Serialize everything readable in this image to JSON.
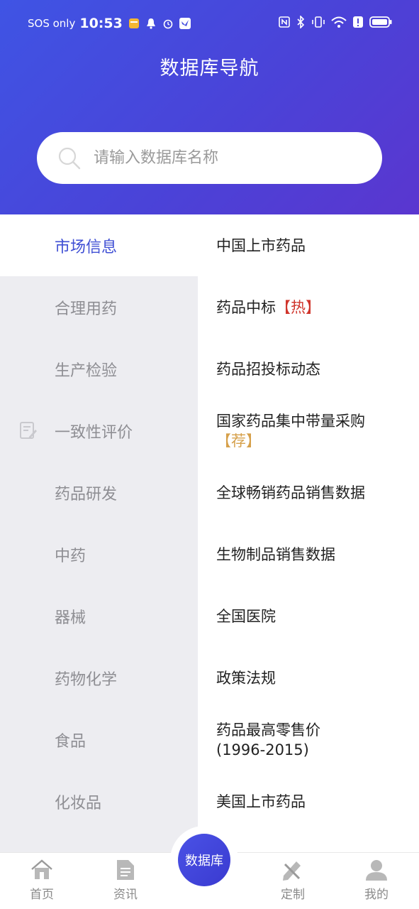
{
  "status_bar": {
    "carrier": "SOS only",
    "time": "10:53"
  },
  "header": {
    "title": "数据库导航"
  },
  "search": {
    "placeholder": "请输入数据库名称",
    "value": ""
  },
  "categories": [
    {
      "label": "市场信息",
      "active": true
    },
    {
      "label": "合理用药"
    },
    {
      "label": "生产检验"
    },
    {
      "label": "一致性评价"
    },
    {
      "label": "药品研发"
    },
    {
      "label": "中药"
    },
    {
      "label": "器械"
    },
    {
      "label": "药物化学"
    },
    {
      "label": "食品"
    },
    {
      "label": "化妆品"
    }
  ],
  "items": [
    {
      "label": "中国上市药品"
    },
    {
      "label": "药品中标",
      "tag_hot": "【热】"
    },
    {
      "label": "药品招投标动态"
    },
    {
      "label": "国家药品集中带量采购",
      "tag_rec": "【荐】"
    },
    {
      "label": "全球畅销药品销售数据"
    },
    {
      "label": "生物制品销售数据"
    },
    {
      "label": "全国医院"
    },
    {
      "label": "政策法规"
    },
    {
      "label": "药品最高零售价",
      "line2": "(1996-2015)"
    },
    {
      "label": "美国上市药品"
    }
  ],
  "bottom_nav": {
    "home": "首页",
    "news": "资讯",
    "database": "数据库",
    "custom": "定制",
    "mine": "我的"
  },
  "colors": {
    "accent": "#3f4fd4",
    "hot": "#d0352c",
    "recommend": "#d6a04a",
    "menu_bg": "#ededf1"
  }
}
